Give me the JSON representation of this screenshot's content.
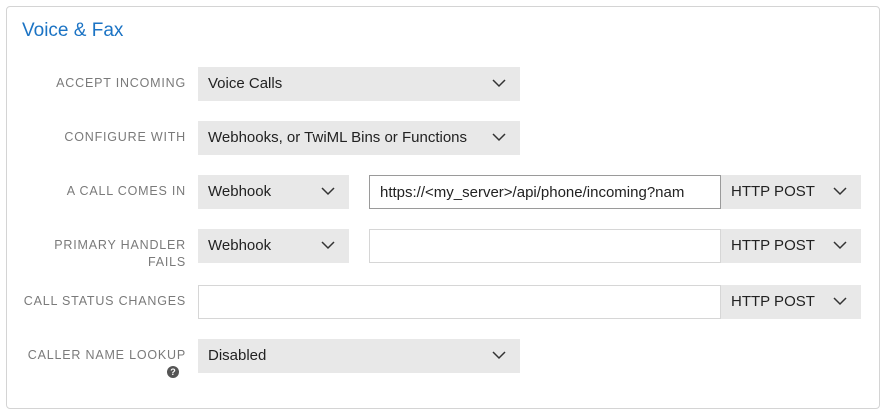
{
  "section": {
    "title": "Voice & Fax"
  },
  "rows": {
    "accept_incoming": {
      "label": "ACCEPT INCOMING",
      "value": "Voice Calls"
    },
    "configure_with": {
      "label": "CONFIGURE WITH",
      "value": "Webhooks, or TwiML Bins or Functions"
    },
    "call_comes_in": {
      "label": "A CALL COMES IN",
      "type": "Webhook",
      "url": "https://<my_server>/api/phone/incoming?nam",
      "method": "HTTP POST"
    },
    "primary_handler_fails": {
      "label_line1": "PRIMARY HANDLER",
      "label_line2": "FAILS",
      "type": "Webhook",
      "url": "",
      "method": "HTTP POST"
    },
    "call_status_changes": {
      "label": "CALL STATUS CHANGES",
      "url": "",
      "method": "HTTP POST"
    },
    "caller_name_lookup": {
      "label": "CALLER NAME LOOKUP",
      "value": "Disabled",
      "help_icon": "question-icon"
    }
  },
  "colors": {
    "title": "#1b73c4",
    "select_bg": "#e8e8e8",
    "label": "#7a7a7a"
  }
}
